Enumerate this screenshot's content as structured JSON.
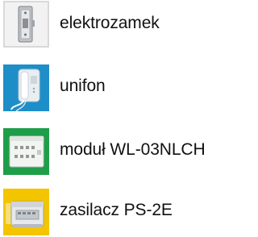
{
  "legend": {
    "items": [
      {
        "label": "elektrozamek",
        "icon": "electric-strike-lock-icon",
        "tile_color": "#f2f2f2"
      },
      {
        "label": "unifon",
        "icon": "intercom-handset-icon",
        "tile_color": "#1e8ec9"
      },
      {
        "label": "moduł WL-03NLCH",
        "icon": "control-module-icon",
        "tile_color": "#1f9e4a"
      },
      {
        "label": "zasilacz PS-2E",
        "icon": "power-supply-icon",
        "tile_color": "#f3c500"
      }
    ]
  }
}
